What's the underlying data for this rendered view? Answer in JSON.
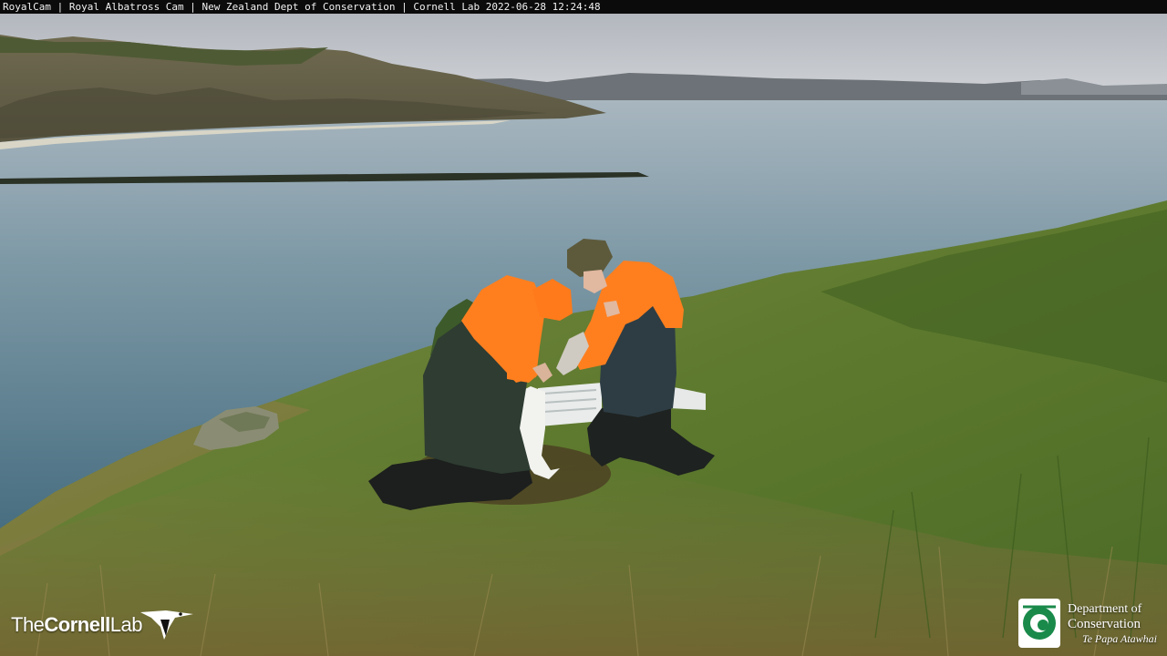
{
  "overlay": {
    "caption": "RoyalCam | Royal Albatross Cam | New Zealand Dept of Conservation | Cornell Lab 2022-06-28 12:24:48"
  },
  "logos": {
    "cornell": {
      "prefix": "The",
      "bold": "Cornell",
      "suffix": "Lab"
    },
    "doc": {
      "line1": "Department of",
      "line2": "Conservation",
      "line3": "Te Papa Atawhai"
    }
  },
  "colors": {
    "sky": "#c9ccd1",
    "water": "#5d7f8f",
    "grass": "#6a7a3a",
    "hi_vis_orange": "#ff7a1a",
    "overall_green": "#2f3d33"
  }
}
